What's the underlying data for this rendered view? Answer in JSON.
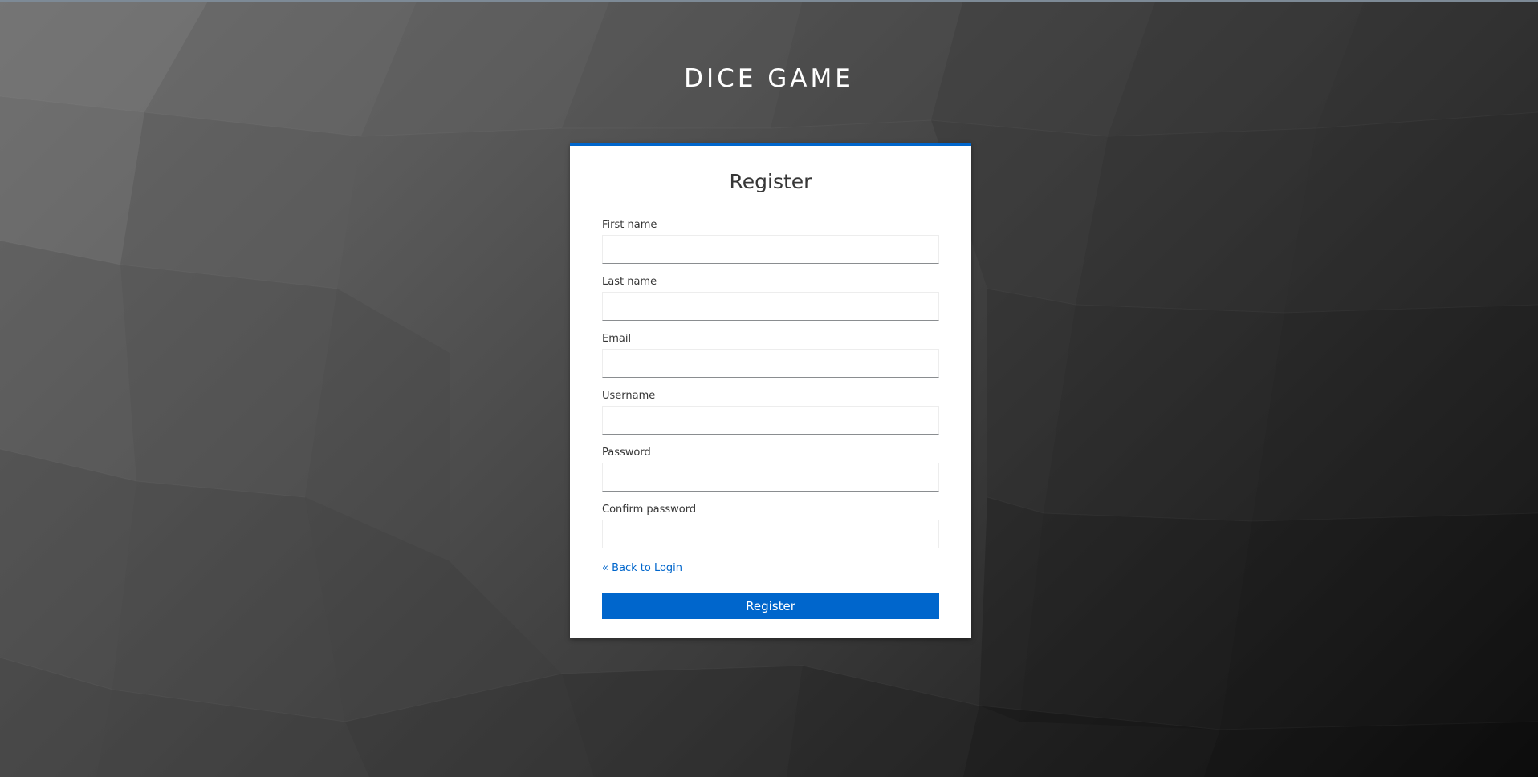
{
  "app": {
    "title": "DICE GAME"
  },
  "form": {
    "heading": "Register",
    "fields": [
      {
        "label": "First name",
        "value": "",
        "placeholder": ""
      },
      {
        "label": "Last name",
        "value": "",
        "placeholder": ""
      },
      {
        "label": "Email",
        "value": "",
        "placeholder": ""
      },
      {
        "label": "Username",
        "value": "",
        "placeholder": ""
      },
      {
        "label": "Password",
        "value": "",
        "placeholder": ""
      },
      {
        "label": "Confirm password",
        "value": "",
        "placeholder": ""
      }
    ],
    "back_link": "« Back to Login",
    "submit_label": "Register"
  },
  "colors": {
    "accent": "#0066cc",
    "background_light": "#6f6f6f",
    "background_dark": "#0e0e0e"
  }
}
